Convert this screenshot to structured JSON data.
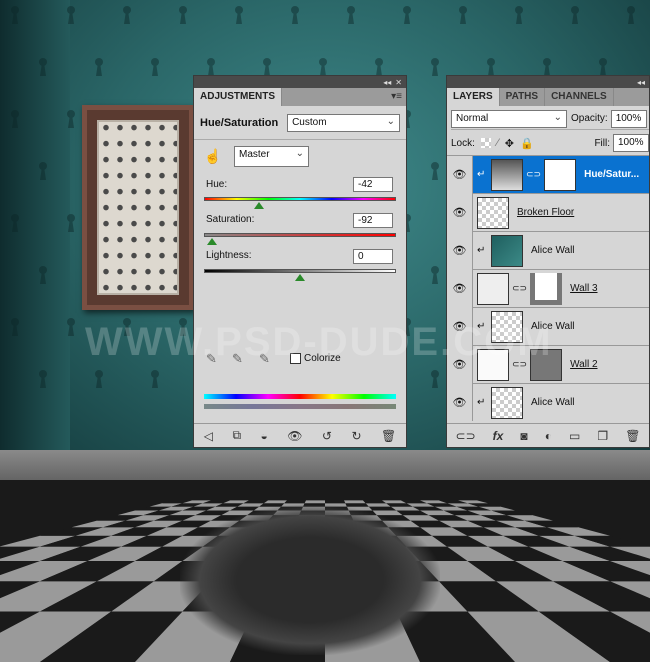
{
  "watermark": "WWW.PSD-DUDE.COM",
  "adjustments": {
    "tab": "ADJUSTMENTS",
    "title": "Hue/Saturation",
    "preset": "Custom",
    "channel": "Master",
    "hue": {
      "label": "Hue:",
      "value": "-42"
    },
    "saturation": {
      "label": "Saturation:",
      "value": "-92"
    },
    "lightness": {
      "label": "Lightness:",
      "value": "0"
    },
    "colorize_label": "Colorize",
    "colorize_checked": false
  },
  "layers_panel": {
    "tabs": [
      "LAYERS",
      "PATHS",
      "CHANNELS"
    ],
    "blend_mode": "Normal",
    "opacity_label": "Opacity:",
    "opacity": "100%",
    "lock_label": "Lock:",
    "fill_label": "Fill:",
    "fill": "100%",
    "layers": [
      {
        "name": "Hue/Satur...",
        "selected": true
      },
      {
        "name": "Broken Floor"
      },
      {
        "name": "Alice Wall"
      },
      {
        "name": "Wall 3"
      },
      {
        "name": "Alice Wall"
      },
      {
        "name": "Wall 2"
      },
      {
        "name": "Alice Wall"
      }
    ]
  }
}
